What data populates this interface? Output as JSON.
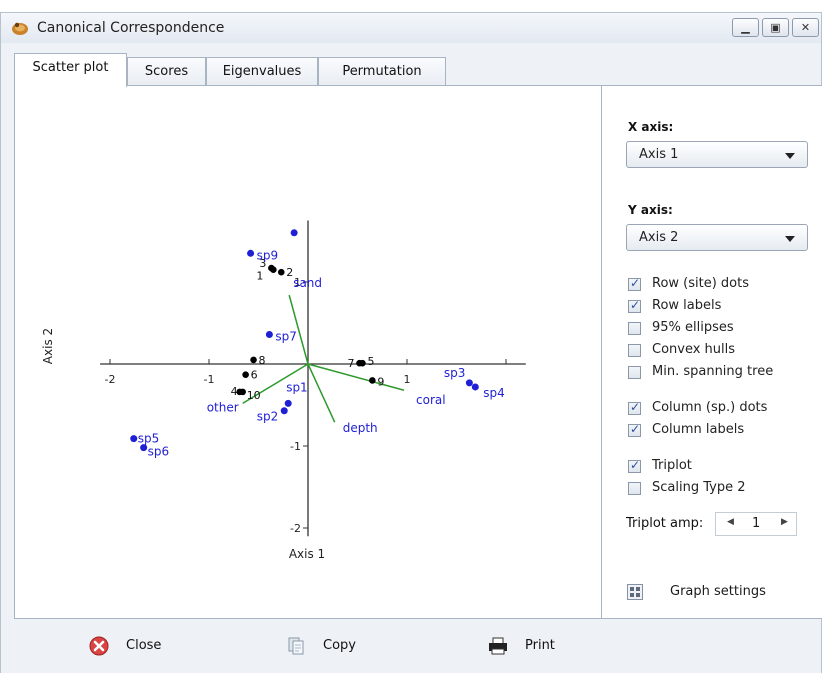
{
  "window": {
    "title": "Canonical Correspondence"
  },
  "tabs": [
    {
      "label": "Scatter plot"
    },
    {
      "label": "Scores"
    },
    {
      "label": "Eigenvalues"
    },
    {
      "label": "Permutation"
    }
  ],
  "controls": {
    "x_axis_label": "X axis:",
    "x_axis_value": "Axis 1",
    "y_axis_label": "Y axis:",
    "y_axis_value": "Axis 2",
    "checkboxes": [
      {
        "label": "Row (site) dots",
        "checked": true
      },
      {
        "label": "Row labels",
        "checked": true
      },
      {
        "label": "95% ellipses",
        "checked": false
      },
      {
        "label": "Convex hulls",
        "checked": false
      },
      {
        "label": "Min. spanning tree",
        "checked": false
      },
      {
        "label": "Column (sp.) dots",
        "checked": true
      },
      {
        "label": "Column labels",
        "checked": true
      },
      {
        "label": "Triplot",
        "checked": true
      },
      {
        "label": "Scaling Type 2",
        "checked": false
      }
    ],
    "triplot_amp_label": "Triplot amp:",
    "triplot_amp_value": "1",
    "graph_settings_label": "Graph settings"
  },
  "bottom": {
    "close_label": "Close",
    "copy_label": "Copy",
    "print_label": "Print"
  },
  "colors": {
    "site": "#000000",
    "species": "#1f1fd6",
    "biplot": "#2e9a2e",
    "axis": "#333333"
  },
  "chart_data": {
    "type": "scatter",
    "xlabel": "Axis 1",
    "ylabel": "Axis 2",
    "xlim": [
      -2.1,
      2.2
    ],
    "ylim": [
      -2.1,
      1.75
    ],
    "x_ticks": [
      -2,
      -1,
      1
    ],
    "y_ticks": [
      1,
      -1,
      -2
    ],
    "sites": [
      {
        "label": "1",
        "x": -0.35,
        "y": 1.15
      },
      {
        "label": "2",
        "x": -0.27,
        "y": 1.12
      },
      {
        "label": "3",
        "x": -0.37,
        "y": 1.17
      },
      {
        "label": "4",
        "x": -0.66,
        "y": -0.34
      },
      {
        "label": "5",
        "x": 0.55,
        "y": 0.01
      },
      {
        "label": "6",
        "x": -0.63,
        "y": -0.13
      },
      {
        "label": "7",
        "x": 0.52,
        "y": 0.01
      },
      {
        "label": "8",
        "x": -0.55,
        "y": 0.05
      },
      {
        "label": "9",
        "x": 0.65,
        "y": -0.2
      },
      {
        "label": "10",
        "x": -0.69,
        "y": -0.34
      }
    ],
    "species": [
      {
        "label": "",
        "x": -0.14,
        "y": 1.6
      },
      {
        "label": "sp9",
        "x": -0.58,
        "y": 1.35
      },
      {
        "label": "sp7",
        "x": -0.39,
        "y": 0.36
      },
      {
        "label": "sp1",
        "x": -0.2,
        "y": -0.48
      },
      {
        "label": "sp2",
        "x": -0.24,
        "y": -0.57
      },
      {
        "label": "sp3",
        "x": 1.63,
        "y": -0.23
      },
      {
        "label": "sp4",
        "x": 1.69,
        "y": -0.28
      },
      {
        "label": "sp5",
        "x": -1.76,
        "y": -0.91
      },
      {
        "label": "sp6",
        "x": -1.66,
        "y": -1.02
      }
    ],
    "biplot": [
      {
        "label": "sand",
        "x": -0.19,
        "y": 0.84
      },
      {
        "label": "coral",
        "x": 0.97,
        "y": -0.32
      },
      {
        "label": "depth",
        "x": 0.27,
        "y": -0.71
      },
      {
        "label": "other",
        "x": -0.66,
        "y": -0.48
      }
    ]
  }
}
